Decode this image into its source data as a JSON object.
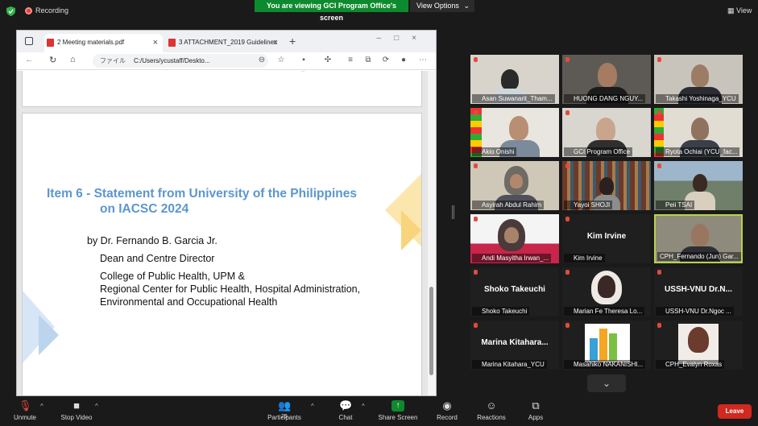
{
  "topbar": {
    "recording": "Recording",
    "viewing_banner": "You are viewing GCI Program Office's screen",
    "view_options": "View Options",
    "view": "View"
  },
  "browser": {
    "tabs": [
      {
        "label": "2 Meeting materials.pdf"
      },
      {
        "label": "3 ATTACHMENT_2019 Guidelines"
      }
    ],
    "url_prefix": "ファイル",
    "url": "C:/Users/ycustaff/Deskto..."
  },
  "pdf": {
    "title_line1": "Item 6 - Statement from University of the Philippines",
    "title_line2": "on IACSC 2024",
    "by": "by Dr. Fernando B. Garcia Jr.",
    "role": "Dean and Centre Director",
    "org1": "College of Public Health, UPM &",
    "org2": "Regional Center for Public Health, Hospital Administration,",
    "org3": "Environmental and Occupational Health"
  },
  "participants": [
    {
      "name": "Asan Suwanarit_Tham..."
    },
    {
      "name": "HUONG DANG NGUY..."
    },
    {
      "name": "Takashi Yoshinaga_YCU"
    },
    {
      "name": "Akio Onishi"
    },
    {
      "name": "GCI Program Office"
    },
    {
      "name": "Ryota Ochiai (YCU_fac..."
    },
    {
      "name": "Asyirah Abdul Rahim"
    },
    {
      "name": "Yayoi SHOJI"
    },
    {
      "name": "Peii TSAI"
    },
    {
      "name": "Andi Masyitha Irwan_..."
    },
    {
      "name": "Kim Irvine",
      "big": "Kim Irvine"
    },
    {
      "name": "CPH_Fernando (Jun) Gar..."
    },
    {
      "name": "Shoko Takeuchi",
      "big": "Shoko Takeuchi"
    },
    {
      "name": "Marian Fe Theresa Lo..."
    },
    {
      "name": "USSH-VNU Dr.Ngoc ...",
      "big": "USSH-VNU  Dr.N..."
    },
    {
      "name": "Marina Kitahara_YCU",
      "big": "Marina  Kitahara..."
    },
    {
      "name": "Masahiko NAKANISHI..."
    },
    {
      "name": "CPH_Evalyn Roxas"
    }
  ],
  "toolbar": {
    "unmute": "Unmute",
    "stop_video": "Stop Video",
    "participants": "Participants",
    "participants_count": "25",
    "chat": "Chat",
    "share_screen": "Share Screen",
    "record": "Record",
    "reactions": "Reactions",
    "apps": "Apps",
    "leave": "Leave"
  },
  "colors": {
    "share_green": "#0e8a2e",
    "leave_red": "#d1281f",
    "title_blue": "#5b96d0",
    "active_speaker": "#b6d34a"
  }
}
